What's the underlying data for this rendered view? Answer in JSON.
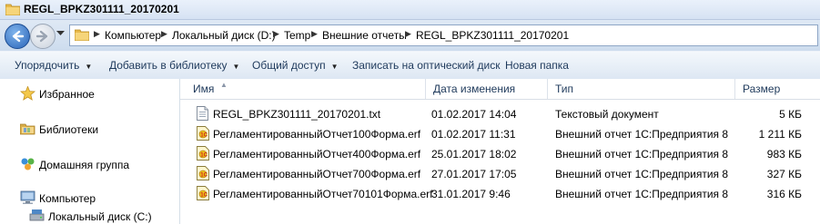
{
  "window": {
    "title": "REGL_BPKZ301111_20170201"
  },
  "address": {
    "crumbs": [
      "Компьютер",
      "Локальный диск (D:)",
      "Temp",
      "Внешние отчеты",
      "REGL_BPKZ301111_20170201"
    ]
  },
  "toolbar": {
    "organize": "Упорядочить",
    "add_library": "Добавить в библиотеку",
    "share": "Общий доступ",
    "burn": "Записать на оптический диск",
    "new_folder": "Новая папка"
  },
  "nav": {
    "favorites": "Избранное",
    "libraries": "Библиотеки",
    "homegroup": "Домашняя группа",
    "computer": "Компьютер",
    "local_disk_c": "Локальный диск (C:)"
  },
  "columns": {
    "name": "Имя",
    "modified": "Дата изменения",
    "type": "Тип",
    "size": "Размер"
  },
  "files": [
    {
      "name": "REGL_BPKZ301111_20170201.txt",
      "modified": "01.02.2017 14:04",
      "type": "Текстовый документ",
      "size": "5 КБ",
      "icon": "text-file-icon"
    },
    {
      "name": "РегламентированныйОтчет100Форма.erf",
      "modified": "01.02.2017 11:31",
      "type": "Внешний отчет 1С:Предприятия 8",
      "size": "1 211 КБ",
      "icon": "1c-report-icon"
    },
    {
      "name": "РегламентированныйОтчет400Форма.erf",
      "modified": "25.01.2017 18:02",
      "type": "Внешний отчет 1С:Предприятия 8",
      "size": "983 КБ",
      "icon": "1c-report-icon"
    },
    {
      "name": "РегламентированныйОтчет700Форма.erf",
      "modified": "27.01.2017 17:05",
      "type": "Внешний отчет 1С:Предприятия 8",
      "size": "327 КБ",
      "icon": "1c-report-icon"
    },
    {
      "name": "РегламентированныйОтчет70101Форма.erf",
      "modified": "31.01.2017 9:46",
      "type": "Внешний отчет 1С:Предприятия 8",
      "size": "316 КБ",
      "icon": "1c-report-icon"
    }
  ]
}
